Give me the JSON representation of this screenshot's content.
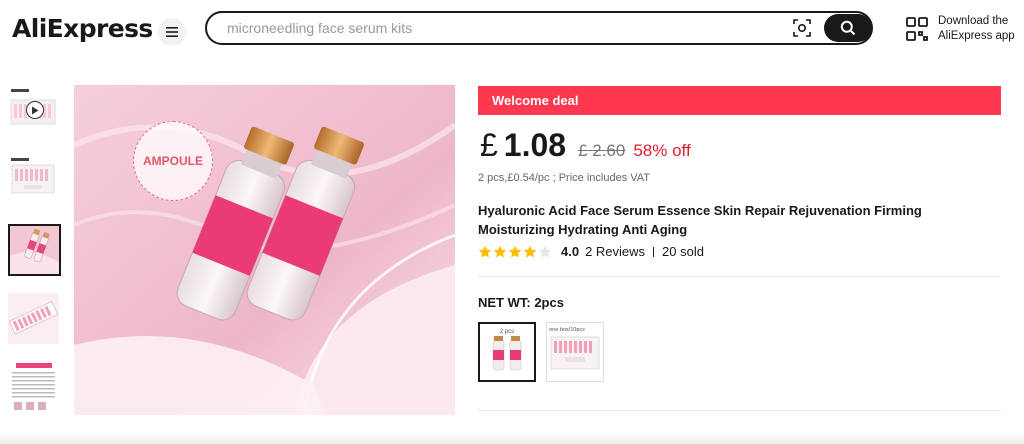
{
  "header": {
    "logo": "AliExpress",
    "search_placeholder": "microneedling face serum kits",
    "download_line1": "Download the",
    "download_line2": "AliExpress app"
  },
  "gallery": {
    "thumbnails": [
      "video-preview",
      "kit-box",
      "two-vials",
      "vial-tray",
      "instructions-sheet"
    ],
    "selected_index": 2,
    "badge_text": "AMPOULE"
  },
  "product": {
    "deal_label": "Welcome deal",
    "currency": "£",
    "price": "1.08",
    "old_price": "£ 2.60",
    "discount": "58% off",
    "unit_line": "2 pcs,£0.54/pc ; Price includes VAT",
    "title": "Hyaluronic Acid Face Serum Essence Skin Repair Rejuvenation Firming Moisturizing Hydrating Anti Aging",
    "rating": "4.0",
    "rating_fraction": 0.8,
    "reviews": "2 Reviews",
    "sold": "20 sold",
    "netwt_label": "NET WT: 2pcs",
    "options": [
      "2 pcs",
      "one box/10pcs"
    ]
  },
  "colors": {
    "deal_bg": "#fd384f",
    "discount": "#e01d2f",
    "star": "#fdbd00",
    "search_button": "#191919"
  }
}
